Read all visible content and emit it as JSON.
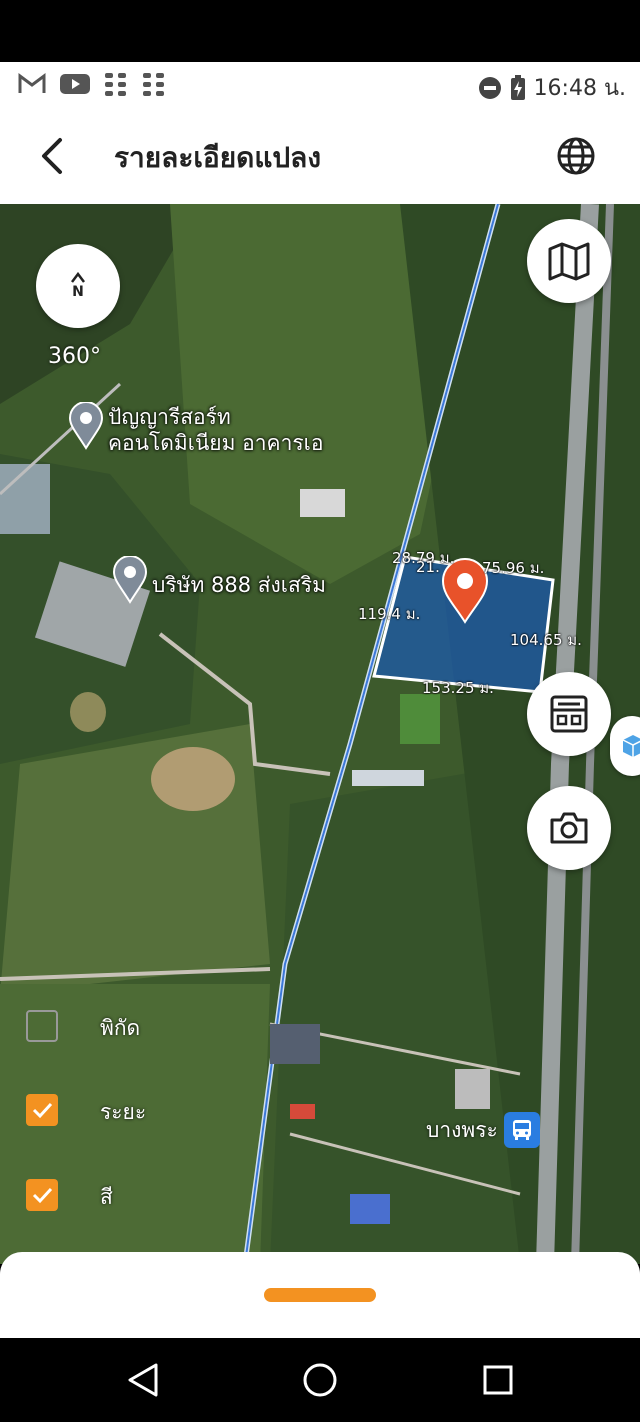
{
  "status_bar": {
    "time": "16:48 น.",
    "left_icons": [
      "gmail-icon",
      "youtube-icon",
      "apps-grid-icon",
      "apps-grid-icon"
    ],
    "right_icons": [
      "do-not-disturb-icon",
      "battery-charging-icon"
    ]
  },
  "header": {
    "title": "รายละเอียดแปลง"
  },
  "map": {
    "compass_letter": "N",
    "rotation_label": "360°",
    "pois": [
      {
        "name_line1": "ปัญญารีสอร์ท",
        "name_line2": "คอนโดมิเนียม อาคารเอ"
      },
      {
        "name_line1": "บริษัท 888 ส่งเสริม",
        "name_line2": ""
      }
    ],
    "plot_dimensions": [
      "28.79 ม.",
      "21.",
      "75.96 ม.",
      "119.4 ม.",
      "104.65 ม.",
      "153.25 ม."
    ],
    "station": "บางพระ",
    "layers": [
      {
        "label": "พิกัด",
        "checked": false
      },
      {
        "label": "ระยะ",
        "checked": true
      },
      {
        "label": "สี",
        "checked": true
      }
    ],
    "colors": {
      "plot_fill": "#1e5aa8",
      "marker": "#e8522a",
      "accent": "#f39221",
      "bus": "#2a7de1"
    }
  }
}
